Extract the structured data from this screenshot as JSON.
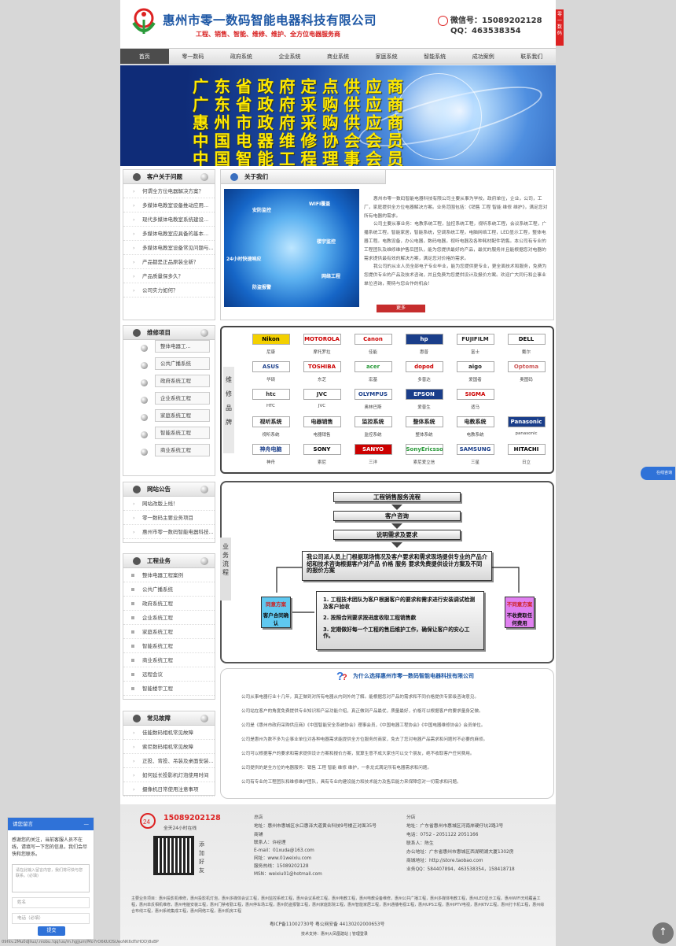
{
  "header": {
    "company": "惠州市零一数码智能电器科技有限公司",
    "slogan": "工程、销售、智能、维修、维护、全方位电器服务商",
    "wechat": "微信号：15089202128",
    "qq": "QQ：463538354"
  },
  "side_tag": "零一数码",
  "nav": [
    "首页",
    "零一数码",
    "政府系统",
    "企业系统",
    "商业系统",
    "家庭系统",
    "智能系统",
    "成功案例",
    "联系我们"
  ],
  "banner": [
    "广东省政府定点供应商",
    "广东省政府采购供应商",
    "惠州市政府采购供应商",
    "中国电器维修协会会员",
    "中国智能工程理事会员"
  ],
  "faq": {
    "title": "客户关于问题",
    "items": [
      "何谓全方位电器解决方案？",
      "多媒体电教室设备推动应用...",
      "现代多媒体电教室系统建设...",
      "多媒体电教室应具备的基本...",
      "多媒体电教室设备常见问题与...",
      "产品都是正品原装全新？",
      "产品质量保多久？",
      "公司实力如何？"
    ]
  },
  "about": {
    "title": "关于我们",
    "img_labels": [
      "安防监控",
      "WIFI覆盖",
      "24小时快速响应",
      "楼宇监控",
      "网络工程",
      "防盗报警"
    ],
    "p1": "惠州市零一数码智能电器科技有限公司主要从事为学校，政府单位，企业，公司，工厂，家庭提供全方位电器解决方案。业务范围包括：《销售 工程 智能 维修 维护》，满足您对所有电器的需求。",
    "p2": "公司主要从事业务：电教系统工程，监控系统工程，视听系统工程，会议系统工程，广播系统工程，智能家居，智能系统，空调系统工程，电脑网络工程，LED显示工程，整体电器工程。电教设备，办公电器，数码电器，视听电器及各种耗材配件销售。本公司有专业的工程团队及维修维护售后团队，能为您提供最好的产品，最优的服务并且能根据您对电器的需求提供最有效的解决方案，满足您对价格的需求。",
    "p3": "我公司的从业人员全部电子专业毕业，能为您提供更专业，更全面技术和服务，免费为您提供专业的产品及技术咨询，并且免费为您提供设计及报价方案。欢迎广大同行和企事业单位咨询，期待与您合作的机会！",
    "more": "更多"
  },
  "repair": {
    "title": "维修项目",
    "items": [
      "整体电器工...",
      "公共广播系统",
      "政府系统工程",
      "企业系统工程",
      "家庭系统工程",
      "智能系统工程",
      "商业系统工程"
    ]
  },
  "brands": {
    "side_label": "维修品牌",
    "items": [
      {
        "logo": "Nikon",
        "name": "尼康"
      },
      {
        "logo": "MOTOROLA",
        "name": "摩托罗拉"
      },
      {
        "logo": "Canon",
        "name": "佳能"
      },
      {
        "logo": "hp",
        "name": "惠普"
      },
      {
        "logo": "FUJIFILM",
        "name": "富士"
      },
      {
        "logo": "DELL",
        "name": "戴尔"
      },
      {
        "logo": "ASUS",
        "name": "华硕"
      },
      {
        "logo": "TOSHIBA",
        "name": "东芝"
      },
      {
        "logo": "acer",
        "name": "宏基"
      },
      {
        "logo": "dopod",
        "name": "多普达"
      },
      {
        "logo": "aigo",
        "name": "爱国者"
      },
      {
        "logo": "Optoma",
        "name": "奥图码"
      },
      {
        "logo": "htc",
        "name": "HTC"
      },
      {
        "logo": "JVC",
        "name": "JVC"
      },
      {
        "logo": "OLYMPUS",
        "name": "奥林巴斯"
      },
      {
        "logo": "EPSON",
        "name": "爱普生"
      },
      {
        "logo": "SIGMA",
        "name": "适马"
      },
      {
        "logo": "",
        "name": ""
      },
      {
        "logo": "视听系统",
        "name": "视听系统"
      },
      {
        "logo": "电器销售",
        "name": "电器销售"
      },
      {
        "logo": "监控系统",
        "name": "监控系统"
      },
      {
        "logo": "整体系统",
        "name": "整体系统"
      },
      {
        "logo": "电教系统",
        "name": "电教系统"
      },
      {
        "logo": "Panasonic",
        "name": "panasonic"
      },
      {
        "logo": "神舟电脑",
        "name": "神舟"
      },
      {
        "logo": "SONY",
        "name": "索尼"
      },
      {
        "logo": "SANYO",
        "name": "三洋"
      },
      {
        "logo": "SonyEricsson",
        "name": "索尼爱立信"
      },
      {
        "logo": "SAMSUNG",
        "name": "三星"
      },
      {
        "logo": "HITACHI",
        "name": "日立"
      }
    ]
  },
  "notice": {
    "title": "网站公告",
    "items": [
      "网站改版上线！",
      "零一数码主要业务项目",
      "惠州市零一数码智能电器科技..."
    ]
  },
  "flow": {
    "side_label": "业务流程",
    "step1": "工程销售服务流程",
    "step2": "客户咨询",
    "step3": "说明需求及要求",
    "step4": "我公司派人员上门根据现场情况及客户要求和需求现场提供专业的产品介绍和技术咨询根据客户对产品 价格 服务 要求免费提供设计方案及不同的报价方案",
    "agree": "同意方案",
    "agree_sub": "客户合同确认",
    "disagree": "不同意方案",
    "disagree_sub": "不收费取任何费用",
    "detail1": "1. 工程技术团队为客户根据客户的要求和需求进行安装调试检测及客户验收",
    "detail2": "2. 按照合同要求按进度收取工程销售款",
    "detail3": "3. 定期做好每一个工程的售后维护工作，确保让客户的安心工作。"
  },
  "engineering": {
    "title": "工程业务",
    "items": [
      "整体电器工程案例",
      "公共广播系统",
      "政府系统工程",
      "企业系统工程",
      "家庭系统工程",
      "智能系统工程",
      "商业系统工程",
      "远程会议",
      "智能楼宇工程"
    ]
  },
  "why": {
    "title": "为什么选择惠州市零一数码智能电器科技有限公司",
    "paras": [
      "公司从事电器行业十几年，真正做到对所有电器从内到外的了解。能根据您对产品的需求和不同价格提供专家级咨询意见。",
      "公司站在客户的角度免费提供专业知识和产品功能介绍，真正做到产品最优，质量最好，价格可以根据客户的要求量身定做。",
      "公司是《惠州市政府采购供应商》《中国智能安全系统协会》理事会员，《中国电器工程协会》《中国电器维修协会》会员单位。",
      "公司是惠州为数不多为企事业单位对各种电器需求能提供全方位服务的商家，免去了您对电器产品需求和问题时不必要的麻烦。",
      "公司可以根据客户的要求和需求提供设计方案和报价方案，就算生意不成大家也可以交个朋友，绝不收取客户任何费用。",
      "公司提供的是全方位的电器服务：销售 工程 智能 维修 维护，一条龙式满足所有电器需求和问题。",
      "公司有专业的工程团队和维修维护团队，具有专业的建设能力和技术能力及售后能力来保障您对一切需求和问题。"
    ]
  },
  "faults": {
    "title": "常见故障",
    "items": [
      "佳能数码相机常见故障",
      "索尼数码相机常见故障",
      "正投、背投、吊装及桌面安装...",
      "如何延长投影机灯泡使用时间",
      "摄像机日常使用注意事项"
    ]
  },
  "footer": {
    "phone": "15089202128",
    "hours": "全天24小时在线",
    "add_friend": "添加好友",
    "hq_title": "总店",
    "hq_lines": [
      "地址：惠州市惠城区水口惠泽大道黄合科技9号楼正对面35号商铺",
      "联系人：许经理",
      "E-mail：01xuda@163.com",
      "网址：www.01weixiu.com",
      "服务热线：15089202128",
      "MSN：weixiu01@hotmail.com"
    ],
    "branch_title": "分店",
    "branch_lines": [
      "地址：广东省惠州市惠城区河南岸硬仔坑2路3号",
      "电话：0752 - 2051122  2051166",
      "联系人：陈生",
      "办公地址：广东省惠州市惠城区西湖明湖大厦1302房",
      "商城地址：http://store.taobao.com",
      "业务QQ：584407894，463538354，158418718"
    ],
    "keywords": "主要业务项目：惠州投影机维修，惠州投影机灯泡，惠州多媒体会议工程，惠州监控系统工程，惠州会议系统工程，惠州电教工程，惠州电教设备维修，惠州公共广播工程，惠州多媒体电教工程，惠州LED显示工程，惠州WIFI无线覆盖工程，惠州单反相机维修，惠州电脑安装工程，惠州门禁考勤工程，惠州停车场工程，惠州防盗报警工程，惠州家庭影院工程，惠州智能家居工程，惠州通播电视工程，惠州UPS工程，惠州IPTV电视，惠州KTV工程，惠州打卡机工程，惠州综合布线工程，惠州系统集成工程，惠州网络工程，惠州机房工程",
    "icp": "粤ICP备11002730号     粤公网安备 44130202000653号",
    "tech": "技术支持：惠州火凤凰建站 | 管理登录"
  },
  "chat": {
    "title": "请您留言",
    "message": "感谢您的关注，当前客服人员不在线，请填写一下您的信息，我们会尽快和您联系。",
    "textarea_placeholder": "请在此输入留言内容，我们将尽快与您联系。(必填)",
    "name_placeholder": "姓名",
    "phone_placeholder": "电话（必填）",
    "submit": "提交"
  },
  "online_service": "在线咨询",
  "status_url": "09htv.2Mu0dJliuz/.niobu.!qq!uu/m.hgjjum/Mo7rO6KUOSUeoNK6dTsHOD)8sBP",
  "colors": {
    "brand_blue": "#1d57a5",
    "accent_red": "#d22222",
    "banner_yellow": "#ffe900",
    "chat_blue": "#2f72d8"
  }
}
